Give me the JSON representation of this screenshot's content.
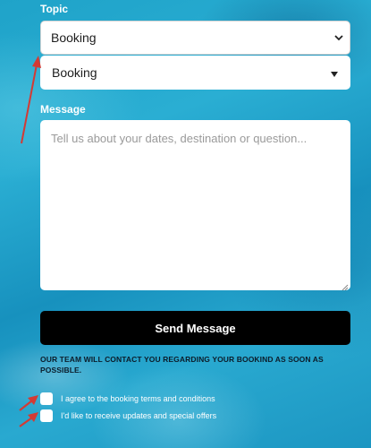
{
  "form": {
    "topic_label": "Topic",
    "topic_native_value": "Booking",
    "topic_custom_value": "Booking",
    "message_label": "Message",
    "message_placeholder": "Tell us about your dates, destination or question...",
    "send_label": "Send Message",
    "notice": "OUR TEAM WILL CONTACT YOU REGARDING YOUR BOOKIND AS SOON AS POSSIBLE.",
    "checkboxes": [
      {
        "label": "I agree to the booking terms and conditions",
        "checked": false
      },
      {
        "label": "I'd like to receive updates and special offers",
        "checked": false
      }
    ]
  },
  "icons": {
    "native_chevron": "chevron-down-icon",
    "custom_caret": "caret-down-icon",
    "resize": "resize-grip-icon",
    "annotation_arrows": "red-arrow-icon"
  },
  "colors": {
    "button_bg": "#000000",
    "annotation_red": "#d33a34",
    "notice_text": "#0b1c2a"
  }
}
